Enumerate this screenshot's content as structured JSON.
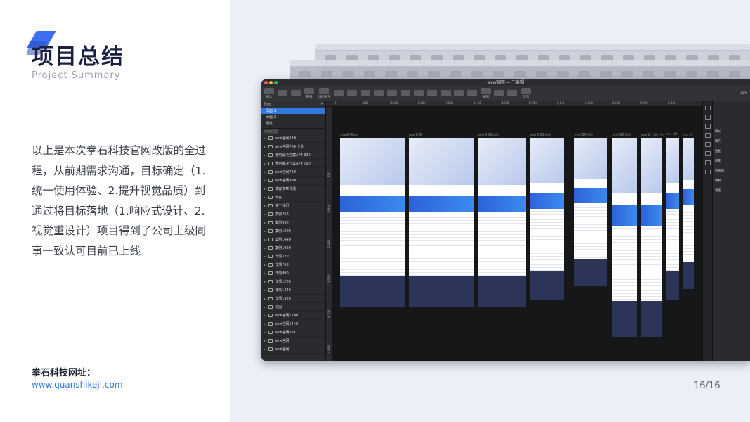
{
  "slide": {
    "title": "项目总结",
    "subtitle": "Project  Summary",
    "summary": "以上是本次拳石科技官网改版的全过程，从前期需求沟通，目标确定（1.统一使用体验、2.提升视觉品质）到通过将目标落地（1.响应式设计、2.视觉重设计）项目得到了公司上级同事一致认可目前已上线",
    "site_label": "拳石科技网址：",
    "site_url": "www.quanshikeji.com",
    "page_number": "16/16",
    "colors": {
      "accent": "#2f7ae0",
      "title": "#1a2140",
      "panel_bg": "#eceff8"
    }
  },
  "app": {
    "doc_title": "new官网 — 已编辑",
    "toolbar": [
      "插入",
      "",
      "",
      "符号",
      "创建组件",
      "",
      "",
      "",
      "",
      "",
      "",
      "",
      "",
      "",
      "",
      "",
      "视图",
      "",
      "",
      "显示"
    ],
    "zoom": "12%",
    "sidebar": {
      "pages_header": "页面",
      "pages": [
        "页面 1",
        "页面 2",
        "组件"
      ],
      "search_placeholder": "搜索图层",
      "layers": [
        "new官网320",
        "new官网760 卡片",
        "通用解决方案APP 320",
        "通用解决方案APP 760",
        "new官网760",
        "new官网990",
        "博客文章详情",
        "博客",
        "关于我们",
        "案例768",
        "案例990",
        "案例1200",
        "案例1440",
        "案例1920",
        "详情320",
        "详情768",
        "详情990",
        "详情1200",
        "详情1440",
        "详情1920",
        "切图",
        "new官网1200",
        "new官网1440",
        "new官网nor",
        "new官网",
        "new官网"
      ]
    },
    "rulers": {
      "top": [
        "0",
        "820",
        "1,640",
        "2,460",
        "3,280",
        "4,100",
        "4,920",
        "5,740",
        "6,560",
        "7,380",
        "8,200",
        "9,020",
        "9,840"
      ],
      "left": [
        "820",
        "1,640",
        "2,460",
        "3,280",
        "4,100",
        "4,920"
      ]
    },
    "artboards": [
      "new官网nor",
      "new官网",
      "new官网1440",
      "new官网1200",
      "new官网990",
      "new官网760",
      "new官...60 卡片",
      "ne...20",
      "ne...片"
    ],
    "right_panel": [
      "样式",
      "填充",
      "边框",
      "阴影",
      "内阴影",
      "模糊",
      "导出"
    ]
  }
}
